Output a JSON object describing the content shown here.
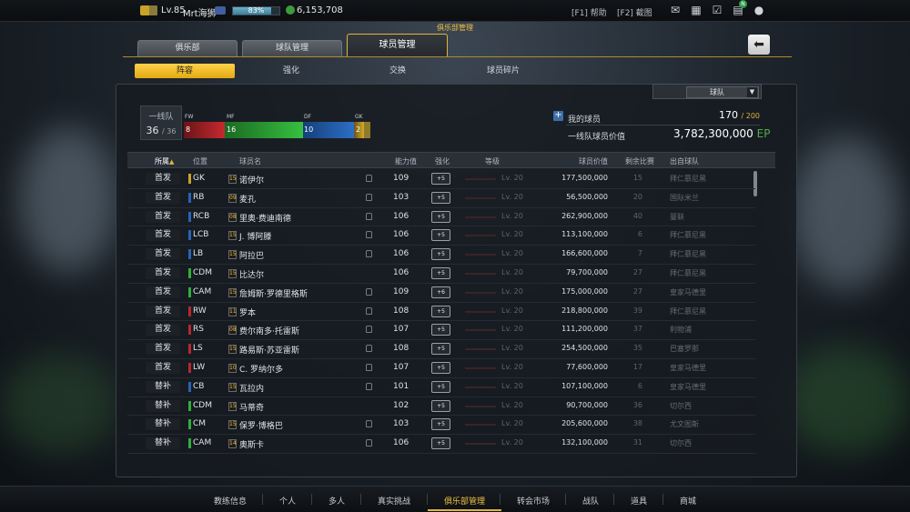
{
  "status_bar": {
    "level": "Lv.85",
    "nickname": "Mrt海狮",
    "exp_percent": "83%",
    "exp_fraction": 0.83,
    "coins": "6,153,708",
    "help_hotkey": "[F1] 帮助",
    "screenshot_hotkey": "[F2] 截图",
    "notification_badge": "N"
  },
  "header": {
    "section_title": "俱乐部管理",
    "tabs": [
      {
        "label": "俱乐部",
        "active": false
      },
      {
        "label": "球队管理",
        "active": false
      },
      {
        "label": "球员管理",
        "active": true
      }
    ],
    "back_icon": "back-arrow-icon"
  },
  "subtabs": [
    {
      "label": "阵容",
      "active": true
    },
    {
      "label": "强化",
      "active": false
    },
    {
      "label": "交换",
      "active": false
    },
    {
      "label": "球员碎片",
      "active": false
    }
  ],
  "filter": {
    "selected": "球队",
    "arrow": "▼"
  },
  "squad": {
    "name": "一线队",
    "count": "36",
    "capacity": "/ 36",
    "positions": [
      {
        "label": "FW",
        "count": "8",
        "color": "#b8262a"
      },
      {
        "label": "MF",
        "count": "16",
        "color": "#2fae3a"
      },
      {
        "label": "DF",
        "count": "10",
        "color": "#2a63b6"
      },
      {
        "label": "GK",
        "count": "2",
        "color": "#c9a227"
      }
    ]
  },
  "summary": {
    "my_players_label": "我的球员",
    "my_players_count": "170",
    "my_players_cap": "/ 200",
    "squad_value_label": "一线队球员价值",
    "squad_value": "3,782,300,000",
    "squad_value_unit": "EP"
  },
  "table": {
    "headers": {
      "role": "所属",
      "sort_indicator": "▲",
      "position": "位置",
      "name": "球员名",
      "ovr": "能力值",
      "enhance": "强化",
      "grade": "等级",
      "price": "球员价值",
      "games": "剩余比赛",
      "club": "出自球队"
    },
    "rows": [
      {
        "role": "首发",
        "pos": "GK",
        "pos_color": "#c9a227",
        "season": "15",
        "name": "诺伊尔",
        "locked": true,
        "ovr": "109",
        "enh": "+5",
        "grade": "Lv. 20",
        "price": "177,500,000",
        "games": "15",
        "club": "拜仁慕尼黑"
      },
      {
        "role": "首发",
        "pos": "RB",
        "pos_color": "#2a63b6",
        "season": "09",
        "name": "麦孔",
        "locked": true,
        "ovr": "103",
        "enh": "+5",
        "grade": "Lv. 20",
        "price": "56,500,000",
        "games": "20",
        "club": "国际米兰"
      },
      {
        "role": "首发",
        "pos": "RCB",
        "pos_color": "#2a63b6",
        "season": "08",
        "name": "里奥·费迪南德",
        "locked": true,
        "ovr": "106",
        "enh": "+5",
        "grade": "Lv. 20",
        "price": "262,900,000",
        "games": "40",
        "club": "曼联"
      },
      {
        "role": "首发",
        "pos": "LCB",
        "pos_color": "#2a63b6",
        "season": "15",
        "name": "J. 博阿滕",
        "locked": true,
        "ovr": "106",
        "enh": "+5",
        "grade": "Lv. 20",
        "price": "113,100,000",
        "games": "6",
        "club": "拜仁慕尼黑"
      },
      {
        "role": "首发",
        "pos": "LB",
        "pos_color": "#2a63b6",
        "season": "15",
        "name": "阿拉巴",
        "locked": true,
        "ovr": "106",
        "enh": "+5",
        "grade": "Lv. 20",
        "price": "166,600,000",
        "games": "7",
        "club": "拜仁慕尼黑"
      },
      {
        "role": "首发",
        "pos": "CDM",
        "pos_color": "#2fae3a",
        "season": "15",
        "name": "比达尔",
        "locked": false,
        "ovr": "106",
        "enh": "+5",
        "grade": "Lv. 20",
        "price": "79,700,000",
        "games": "27",
        "club": "拜仁慕尼黑"
      },
      {
        "role": "首发",
        "pos": "CAM",
        "pos_color": "#2fae3a",
        "season": "15",
        "name": "詹姆斯·罗德里格斯",
        "locked": true,
        "ovr": "109",
        "enh": "+6",
        "grade": "Lv. 20",
        "price": "175,000,000",
        "games": "27",
        "club": "皇家马德里"
      },
      {
        "role": "首发",
        "pos": "RW",
        "pos_color": "#b8262a",
        "season": "11",
        "name": "罗本",
        "locked": true,
        "ovr": "108",
        "enh": "+5",
        "grade": "Lv. 20",
        "price": "218,800,000",
        "games": "39",
        "club": "拜仁慕尼黑"
      },
      {
        "role": "首发",
        "pos": "RS",
        "pos_color": "#b8262a",
        "season": "08",
        "name": "费尔南多·托雷斯",
        "locked": true,
        "ovr": "107",
        "enh": "+5",
        "grade": "Lv. 20",
        "price": "111,200,000",
        "games": "37",
        "club": "利物浦"
      },
      {
        "role": "首发",
        "pos": "LS",
        "pos_color": "#b8262a",
        "season": "15",
        "name": "路易斯·苏亚雷斯",
        "locked": true,
        "ovr": "108",
        "enh": "+5",
        "grade": "Lv. 20",
        "price": "254,500,000",
        "games": "35",
        "club": "巴塞罗那"
      },
      {
        "role": "首发",
        "pos": "LW",
        "pos_color": "#b8262a",
        "season": "10",
        "name": "C. 罗纳尔多",
        "locked": true,
        "ovr": "107",
        "enh": "+5",
        "grade": "Lv. 20",
        "price": "77,600,000",
        "games": "17",
        "club": "皇家马德里"
      },
      {
        "role": "替补",
        "pos": "CB",
        "pos_color": "#2a63b6",
        "season": "15",
        "name": "瓦拉内",
        "locked": true,
        "ovr": "101",
        "enh": "+5",
        "grade": "Lv. 20",
        "price": "107,100,000",
        "games": "6",
        "club": "皇家马德里"
      },
      {
        "role": "替补",
        "pos": "CDM",
        "pos_color": "#2fae3a",
        "season": "15",
        "name": "马蒂奇",
        "locked": false,
        "ovr": "102",
        "enh": "+5",
        "grade": "Lv. 20",
        "price": "90,700,000",
        "games": "36",
        "club": "切尔西"
      },
      {
        "role": "替补",
        "pos": "CM",
        "pos_color": "#2fae3a",
        "season": "15",
        "name": "保罗·博格巴",
        "locked": true,
        "ovr": "103",
        "enh": "+5",
        "grade": "Lv. 20",
        "price": "205,600,000",
        "games": "38",
        "club": "尤文图斯"
      },
      {
        "role": "替补",
        "pos": "CAM",
        "pos_color": "#2fae3a",
        "season": "14",
        "name": "奥斯卡",
        "locked": true,
        "ovr": "106",
        "enh": "+5",
        "grade": "Lv. 20",
        "price": "132,100,000",
        "games": "31",
        "club": "切尔西"
      }
    ]
  },
  "bottom_nav": [
    {
      "label": "教练信息",
      "active": false
    },
    {
      "label": "个人",
      "active": false
    },
    {
      "label": "多人",
      "active": false
    },
    {
      "label": "真实挑战",
      "active": false
    },
    {
      "label": "俱乐部管理",
      "active": true
    },
    {
      "label": "转会市场",
      "active": false
    },
    {
      "label": "战队",
      "active": false
    },
    {
      "label": "道具",
      "active": false
    },
    {
      "label": "商城",
      "active": false
    }
  ]
}
